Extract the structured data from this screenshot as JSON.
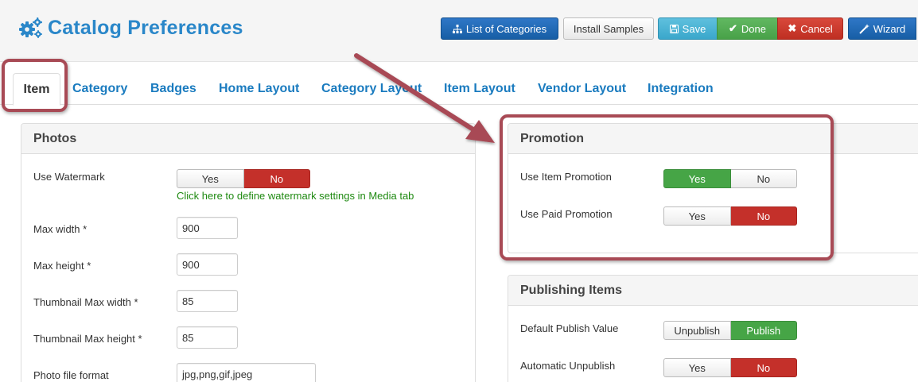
{
  "header": {
    "title": "Catalog Preferences",
    "title_icon": "gears-icon",
    "toolbar": {
      "list_categories": "List of Categories",
      "install_samples": "Install Samples",
      "save": "Save",
      "done": "Done",
      "cancel": "Cancel",
      "wizard": "Wizard"
    }
  },
  "tabs": [
    {
      "label": "Item",
      "active": true
    },
    {
      "label": "Category"
    },
    {
      "label": "Badges"
    },
    {
      "label": "Home Layout"
    },
    {
      "label": "Category Layout"
    },
    {
      "label": "Item Layout"
    },
    {
      "label": "Vendor Layout"
    },
    {
      "label": "Integration"
    }
  ],
  "photos": {
    "heading": "Photos",
    "use_watermark": {
      "label": "Use Watermark",
      "yes": "Yes",
      "no": "No",
      "value": "No"
    },
    "watermark_hint": "Click here to define watermark settings in Media tab",
    "max_width": {
      "label": "Max width *",
      "value": "900"
    },
    "max_height": {
      "label": "Max height *",
      "value": "900"
    },
    "thumb_max_width": {
      "label": "Thumbnail Max width *",
      "value": "85"
    },
    "thumb_max_height": {
      "label": "Thumbnail Max height *",
      "value": "85"
    },
    "photo_format": {
      "label": "Photo file format",
      "value": "jpg,png,gif,jpeg"
    }
  },
  "promotion": {
    "heading": "Promotion",
    "use_item_promotion": {
      "label": "Use Item Promotion",
      "yes": "Yes",
      "no": "No",
      "value": "Yes"
    },
    "use_paid_promotion": {
      "label": "Use Paid Promotion",
      "yes": "Yes",
      "no": "No",
      "value": "No"
    }
  },
  "publishing": {
    "heading": "Publishing Items",
    "default_publish": {
      "label": "Default Publish Value",
      "unpublish": "Unpublish",
      "publish": "Publish",
      "value": "Publish"
    },
    "auto_unpublish": {
      "label": "Automatic Unpublish",
      "yes": "Yes",
      "no": "No",
      "value": "No"
    }
  },
  "colors": {
    "title_blue": "#2a87c9",
    "tab_blue": "#1a7bbf",
    "toggle_green": "#46a546",
    "toggle_red": "#c4302a",
    "callout": "#a84a55",
    "hint_green": "#1f8a12"
  }
}
